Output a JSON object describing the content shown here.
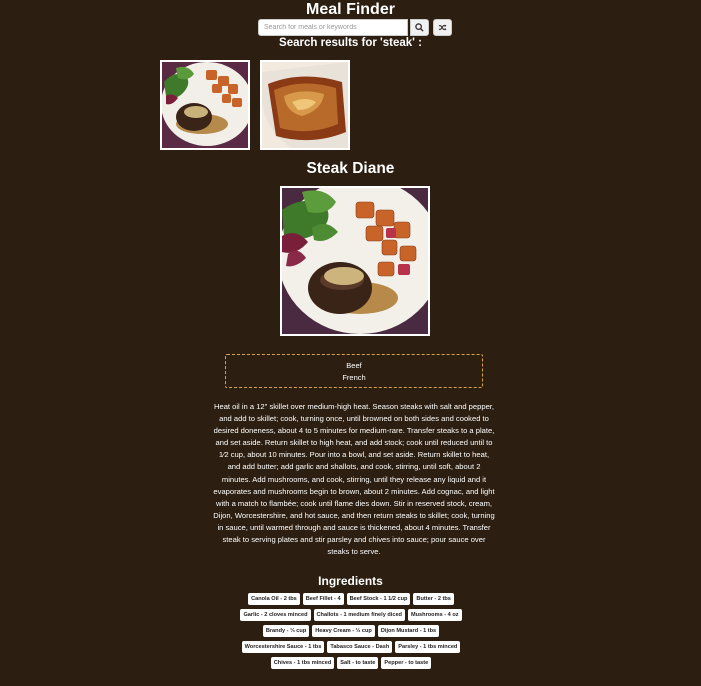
{
  "app": {
    "title": "Meal Finder"
  },
  "search": {
    "placeholder": "Search for meals or keywords",
    "value": "",
    "search_icon": "search-icon",
    "random_icon": "shuffle-icon"
  },
  "results": {
    "heading": "Search results for 'steak' :",
    "thumbnails": [
      {
        "name": "steak-diane-thumbnail",
        "picture": "steak with salad and roasted potatoes"
      },
      {
        "name": "steak-pie-thumbnail",
        "picture": "baked pie in dish"
      }
    ]
  },
  "meal": {
    "title": "Steak Diane",
    "category": "Beef",
    "area": "French",
    "instructions": "Heat oil in a 12\" skillet over medium-high heat. Season steaks with salt and pepper, and add to skillet; cook, turning once, until browned on both sides and cooked to desired doneness, about 4 to 5 minutes for medium-rare. Transfer steaks to a plate, and set aside. Return skillet to high heat, and add stock; cook until reduced until to 1⁄2 cup, about 10 minutes. Pour into a bowl, and set aside. Return skillet to heat, and add butter; add garlic and shallots, and cook, stirring, until soft, about 2 minutes. Add mushrooms, and cook, stirring, until they release any liquid and it evaporates and mushrooms begin to brown, about 2 minutes. Add cognac, and light with a match to flambée; cook until flame dies down. Stir in reserved stock, cream, Dijon, Worcestershire, and hot sauce, and then return steaks to skillet; cook, turning in sauce, until warmed through and sauce is thickened, about 4 minutes. Transfer steak to serving plates and stir parsley and chives into sauce; pour sauce over steaks to serve.",
    "ingredients_heading": "Ingredients",
    "ingredients": [
      "Canola Oil - 2 tbs",
      "Beef Fillet - 4",
      "Beef Stock - 1 1/2 cup",
      "Butter - 2 tbs",
      "Garlic - 2 cloves minced",
      "Challots - 1 medium finely diced",
      "Mushrooms - 4 oz",
      "Brandy - ⅓ cup",
      "Heavy Cream - ⅓ cup",
      "Dijon Mustard - 1 tbs",
      "Worcestershire Sauce - 1 tbs",
      "Tabasco Sauce - Dash",
      "Parsley - 1 tbs minced",
      "Chives - 1 tbs minced",
      "Salt - to taste",
      "Pepper - to taste"
    ]
  },
  "colors": {
    "background": "#2c1f12",
    "info_border": "#d9a441",
    "text": "#ffffff"
  }
}
